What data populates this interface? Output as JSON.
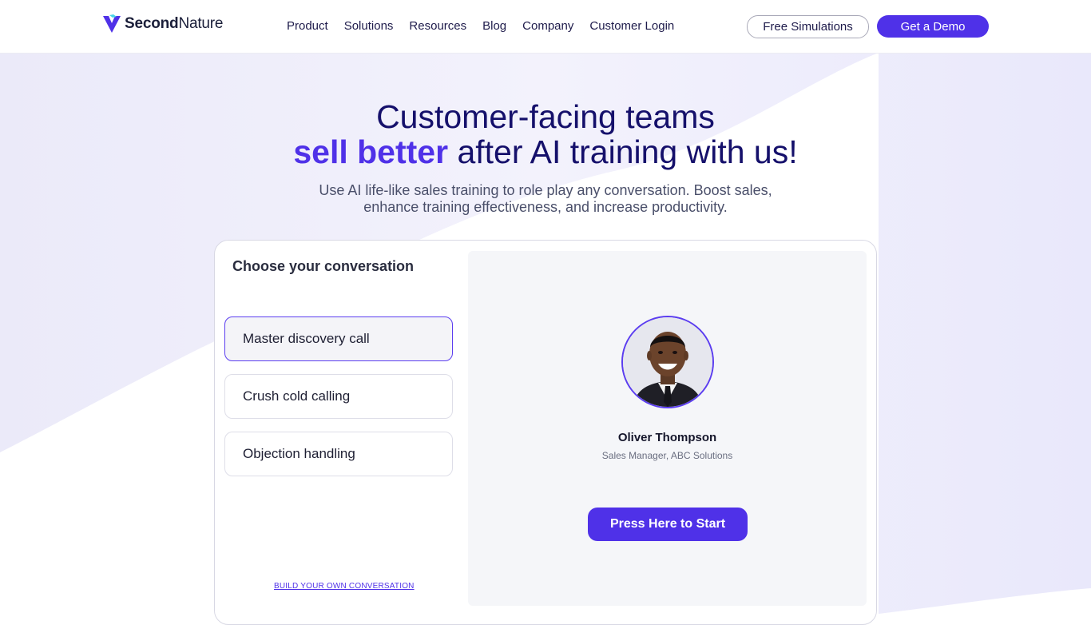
{
  "brand": {
    "logo_text_bold": "Second",
    "logo_text_regular": "Nature",
    "accent_color": "#4f31e8"
  },
  "nav": {
    "items": [
      "Product",
      "Solutions",
      "Resources",
      "Blog",
      "Company",
      "Customer Login"
    ]
  },
  "header_buttons": {
    "free_simulations": "Free Simulations",
    "get_demo": "Get a Demo"
  },
  "hero": {
    "line1": "Customer-facing teams",
    "accent": "sell better",
    "line2_rest": "after AI training with us!",
    "sub_line1": "Use AI life-like sales training to role play any conversation. Boost sales,",
    "sub_line2": "enhance training effectiveness, and increase productivity."
  },
  "conversation": {
    "title": "Choose your conversation",
    "options": [
      {
        "label": "Master discovery call",
        "selected": true
      },
      {
        "label": "Crush cold calling",
        "selected": false
      },
      {
        "label": "Objection handling",
        "selected": false
      }
    ],
    "build_link": "BUILD YOUR OWN CONVERSATION"
  },
  "persona": {
    "name": "Oliver Thompson",
    "role": "Sales Manager, ABC Solutions",
    "start_button": "Press Here to Start"
  }
}
